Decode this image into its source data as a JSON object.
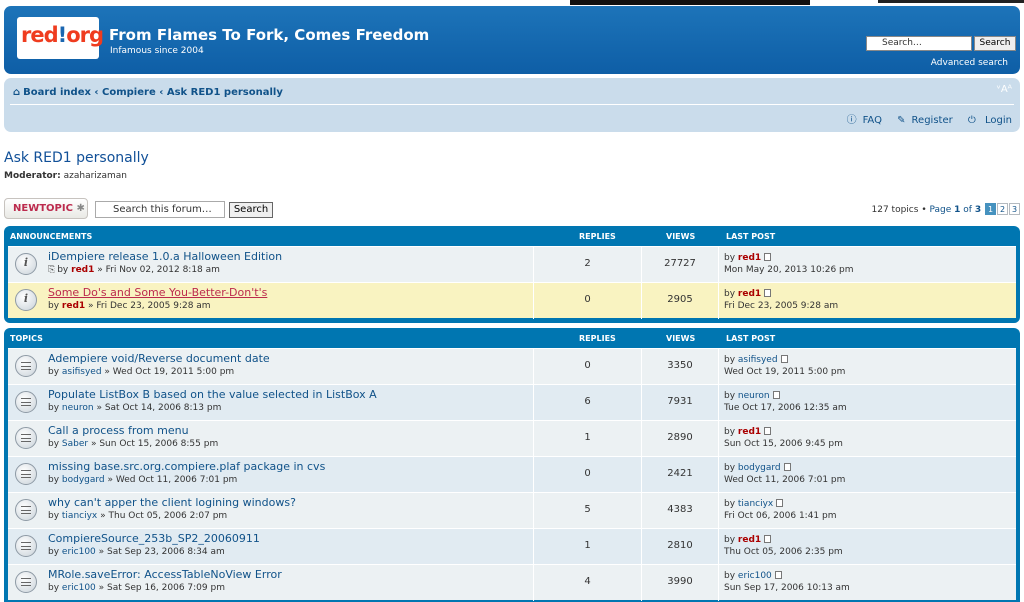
{
  "site": {
    "logo_text": "red1.org",
    "title": "From Flames To Fork, Comes Freedom",
    "subtitle": "Infamous since 2004",
    "search_placeholder": "Search…",
    "search_button": "Search",
    "advanced_search": "Advanced search"
  },
  "nav": {
    "breadcrumb": [
      "Board index",
      "Compiere",
      "Ask RED1 personally"
    ],
    "separator": "‹",
    "font_size_toggle": "ᵛAᴬ",
    "links": [
      "FAQ",
      "Register",
      "Login"
    ]
  },
  "forum": {
    "title": "Ask RED1 personally",
    "moderator_label": "Moderator:",
    "moderator": "azaharizaman",
    "new_topic": "NEWTOPIC",
    "search_placeholder": "Search this forum…",
    "search_button": "Search",
    "topic_count": "127 topics",
    "page_label": "Page",
    "page_current": "1",
    "page_of": "of",
    "page_total": "3",
    "pages": [
      "1",
      "2",
      "3"
    ]
  },
  "columns": {
    "replies": "REPLIES",
    "views": "VIEWS",
    "last_post": "LAST POST"
  },
  "announcements": {
    "header": "ANNOUNCEMENTS",
    "rows": [
      {
        "title": "iDempiere release 1.0.a Halloween Edition",
        "by": "by",
        "author": "red1",
        "author_admin": true,
        "date": "» Fri Nov 02, 2012 8:18 am",
        "replies": "2",
        "views": "27727",
        "last_by": "red1",
        "last_admin": true,
        "last_date": "Mon May 20, 2013 10:26 pm",
        "attachment": true
      },
      {
        "title": "Some Do's and Some You-Better-Don't's",
        "by": "by",
        "author": "red1",
        "author_admin": true,
        "date": "» Fri Dec 23, 2005 9:28 am",
        "replies": "0",
        "views": "2905",
        "last_by": "red1",
        "last_admin": true,
        "last_date": "Fri Dec 23, 2005 9:28 am",
        "attachment": false
      }
    ]
  },
  "topics": {
    "header": "TOPICS",
    "rows": [
      {
        "title": "Adempiere void/Reverse document date",
        "author": "asifisyed",
        "date": "» Wed Oct 19, 2011 5:00 pm",
        "replies": "0",
        "views": "3350",
        "last_by": "asifisyed",
        "last_date": "Wed Oct 19, 2011 5:00 pm"
      },
      {
        "title": "Populate ListBox B based on the value selected in ListBox A",
        "author": "neuron",
        "date": "» Sat Oct 14, 2006 8:13 pm",
        "replies": "6",
        "views": "7931",
        "last_by": "neuron",
        "last_date": "Tue Oct 17, 2006 12:35 am"
      },
      {
        "title": "Call a process from menu",
        "author": "Saber",
        "date": "» Sun Oct 15, 2006 8:55 pm",
        "replies": "1",
        "views": "2890",
        "last_by": "red1",
        "last_admin": true,
        "last_date": "Sun Oct 15, 2006 9:45 pm"
      },
      {
        "title": "missing base.src.org.compiere.plaf package in cvs",
        "author": "bodygard",
        "date": "» Wed Oct 11, 2006 7:01 pm",
        "replies": "0",
        "views": "2421",
        "last_by": "bodygard",
        "last_date": "Wed Oct 11, 2006 7:01 pm"
      },
      {
        "title": "why can't apper the client logining windows?",
        "author": "tianciyx",
        "date": "» Thu Oct 05, 2006 2:07 pm",
        "replies": "5",
        "views": "4383",
        "last_by": "tianciyx",
        "last_date": "Fri Oct 06, 2006 1:41 pm"
      },
      {
        "title": "CompiereSource_253b_SP2_20060911",
        "author": "eric100",
        "date": "» Sat Sep 23, 2006 8:34 am",
        "replies": "1",
        "views": "2810",
        "last_by": "red1",
        "last_admin": true,
        "last_date": "Thu Oct 05, 2006 2:35 pm"
      },
      {
        "title": "MRole.saveError: AccessTableNoView Error",
        "author": "eric100",
        "date": "» Sat Sep 16, 2006 7:09 pm",
        "replies": "4",
        "views": "3990",
        "last_by": "eric100",
        "last_date": "Sun Sep 17, 2006 10:13 am"
      }
    ]
  },
  "colors": {
    "header_blue": "#0e5ea6",
    "navbar": "#cadceb",
    "panel_blue": "#0076b1",
    "sticky_row": "#f9f3c1",
    "admin_red": "#aa0000",
    "link_blue": "#105289"
  }
}
